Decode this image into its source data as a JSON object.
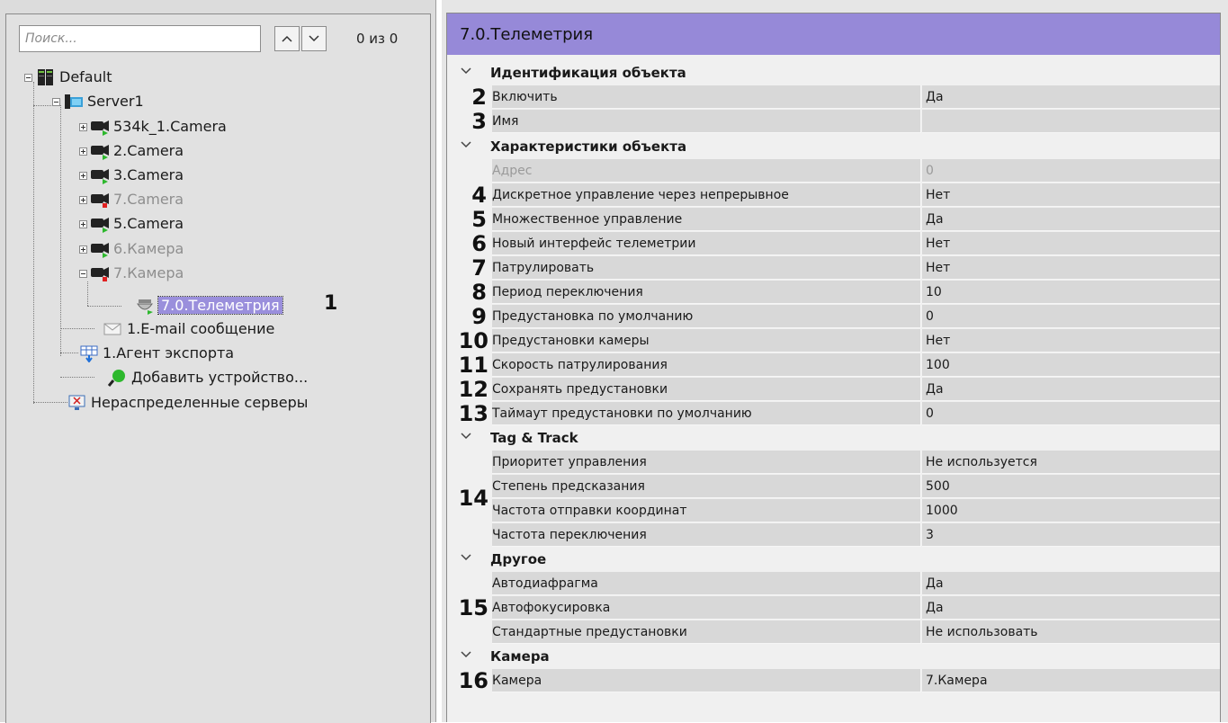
{
  "left": {
    "search_placeholder": "Поиск...",
    "counter": "0 из 0",
    "tree": [
      {
        "label": "Default",
        "disabled": false
      },
      {
        "label": "Server1",
        "disabled": false
      },
      {
        "label": "534k_1.Camera",
        "disabled": false
      },
      {
        "label": "2.Camera",
        "disabled": false
      },
      {
        "label": "3.Camera",
        "disabled": false
      },
      {
        "label": "7.Camera",
        "disabled": true
      },
      {
        "label": "5.Camera",
        "disabled": false
      },
      {
        "label": "6.Камера",
        "disabled": true
      },
      {
        "label": "7.Камера",
        "disabled": true
      },
      {
        "label": "7.0.Телеметрия",
        "disabled": false,
        "selected": true
      },
      {
        "label": "1.E-mail сообщение",
        "disabled": false
      },
      {
        "label": "1.Агент экспорта",
        "disabled": false
      },
      {
        "label": "Добавить устройство...",
        "disabled": false
      },
      {
        "label": "Нераспределенные серверы",
        "disabled": false
      }
    ],
    "selected_marker": "1"
  },
  "right": {
    "title": "7.0.Телеметрия",
    "sections": {
      "identification": "Идентификация объекта",
      "characteristics": "Характеристики объекта",
      "tagtrack": "Tag & Track",
      "other": "Другое",
      "camera": "Камера"
    },
    "props": [
      {
        "name": "Включить",
        "value": "Да",
        "marker": "2"
      },
      {
        "name": "Имя",
        "value": "",
        "marker": "3"
      },
      {
        "name": "Адрес",
        "value": "0",
        "marker": "",
        "disabled": true
      },
      {
        "name": "Дискретное управление через непрерывное",
        "value": "Нет",
        "marker": "4"
      },
      {
        "name": "Множественное управление",
        "value": "Да",
        "marker": "5"
      },
      {
        "name": "Новый интерфейс телеметрии",
        "value": "Нет",
        "marker": "6"
      },
      {
        "name": "Патрулировать",
        "value": "Нет",
        "marker": "7"
      },
      {
        "name": "Период переключения",
        "value": "10",
        "marker": "8"
      },
      {
        "name": "Предустановка по умолчанию",
        "value": "0",
        "marker": "9"
      },
      {
        "name": "Предустановки камеры",
        "value": "Нет",
        "marker": "10"
      },
      {
        "name": "Скорость патрулирования",
        "value": "100",
        "marker": "11"
      },
      {
        "name": "Сохранять предустановки",
        "value": "Да",
        "marker": "12"
      },
      {
        "name": "Таймаут предустановки по умолчанию",
        "value": "0",
        "marker": "13"
      },
      {
        "name": "Приоритет управления",
        "value": "Не используется",
        "marker": ""
      },
      {
        "name": "Степень предсказания",
        "value": "500",
        "marker": ""
      },
      {
        "name": "Частота отправки координат",
        "value": "1000",
        "marker": ""
      },
      {
        "name": "Частота переключения",
        "value": "3",
        "marker": ""
      },
      {
        "name": "Автодиафрагма",
        "value": "Да",
        "marker": ""
      },
      {
        "name": "Автофокусировка",
        "value": "Да",
        "marker": ""
      },
      {
        "name": "Стандартные предустановки",
        "value": "Не использовать",
        "marker": ""
      },
      {
        "name": "Камера",
        "value": "7.Камера",
        "marker": "16"
      }
    ],
    "group_markers": {
      "tagtrack": "14",
      "other": "15"
    }
  }
}
